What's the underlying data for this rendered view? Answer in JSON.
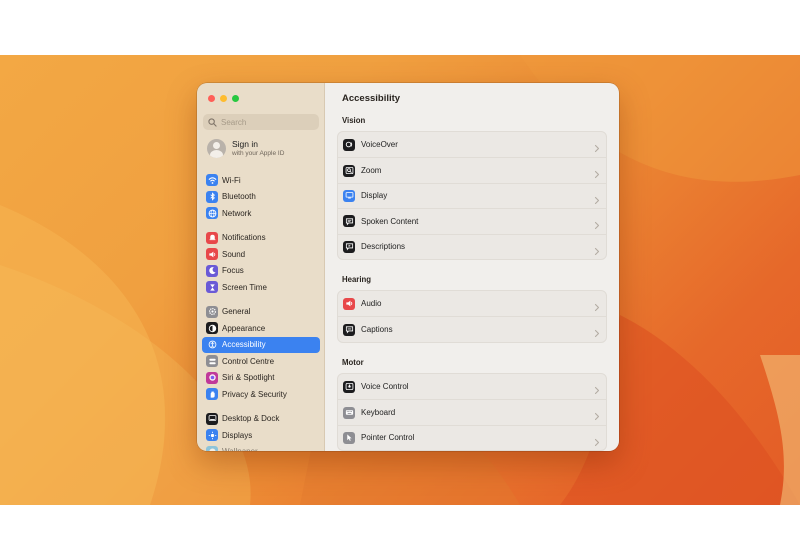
{
  "window": {
    "traffic_lights": {
      "close": "#ff5f57",
      "minimize": "#febc2e",
      "maximize": "#28c840"
    }
  },
  "sidebar": {
    "search": {
      "placeholder": "Search",
      "value": ""
    },
    "account": {
      "name": "Sign in",
      "subtitle": "with your Apple ID"
    },
    "groups": [
      [
        {
          "label": "Wi-Fi",
          "icon": "wifi-icon",
          "color": "#3b82f0"
        },
        {
          "label": "Bluetooth",
          "icon": "bluetooth-icon",
          "color": "#3b82f0"
        },
        {
          "label": "Network",
          "icon": "globe-icon",
          "color": "#3b82f0"
        }
      ],
      [
        {
          "label": "Notifications",
          "icon": "bell-icon",
          "color": "#e8484a"
        },
        {
          "label": "Sound",
          "icon": "speaker-icon",
          "color": "#e8484a"
        },
        {
          "label": "Focus",
          "icon": "moon-icon",
          "color": "#6a5ad6"
        },
        {
          "label": "Screen Time",
          "icon": "hourglass-icon",
          "color": "#6a5ad6"
        }
      ],
      [
        {
          "label": "General",
          "icon": "gear-icon",
          "color": "#8e8e93"
        },
        {
          "label": "Appearance",
          "icon": "appearance-icon",
          "color": "#1c1c1e"
        },
        {
          "label": "Accessibility",
          "icon": "accessibility-icon",
          "color": "#3b82f0",
          "selected": true
        },
        {
          "label": "Control Centre",
          "icon": "control-centre-icon",
          "color": "#8e8e93"
        },
        {
          "label": "Siri & Spotlight",
          "icon": "siri-icon",
          "color": "#c0399a"
        },
        {
          "label": "Privacy & Security",
          "icon": "hand-icon",
          "color": "#3b82f0"
        }
      ],
      [
        {
          "label": "Desktop & Dock",
          "icon": "dock-icon",
          "color": "#1c1c1e"
        },
        {
          "label": "Displays",
          "icon": "sun-icon",
          "color": "#3b82f0"
        },
        {
          "label": "Wallpaper",
          "icon": "wallpaper-icon",
          "color": "#42b0e8"
        }
      ]
    ]
  },
  "main": {
    "title": "Accessibility",
    "sections": [
      {
        "label": "Vision",
        "rows": [
          {
            "label": "VoiceOver",
            "icon": "voiceover-icon",
            "color": "#1c1c1e"
          },
          {
            "label": "Zoom",
            "icon": "zoom-icon",
            "color": "#1c1c1e"
          },
          {
            "label": "Display",
            "icon": "display-icon",
            "color": "#3b82f0"
          },
          {
            "label": "Spoken Content",
            "icon": "speech-bubble-icon",
            "color": "#1c1c1e"
          },
          {
            "label": "Descriptions",
            "icon": "descriptions-icon",
            "color": "#1c1c1e"
          }
        ]
      },
      {
        "label": "Hearing",
        "rows": [
          {
            "label": "Audio",
            "icon": "speaker-icon",
            "color": "#e8484a"
          },
          {
            "label": "Captions",
            "icon": "captions-icon",
            "color": "#1c1c1e"
          }
        ]
      },
      {
        "label": "Motor",
        "rows": [
          {
            "label": "Voice Control",
            "icon": "voice-control-icon",
            "color": "#1c1c1e"
          },
          {
            "label": "Keyboard",
            "icon": "keyboard-icon",
            "color": "#8e8e93"
          },
          {
            "label": "Pointer Control",
            "icon": "pointer-icon",
            "color": "#8e8e93"
          }
        ]
      }
    ]
  }
}
